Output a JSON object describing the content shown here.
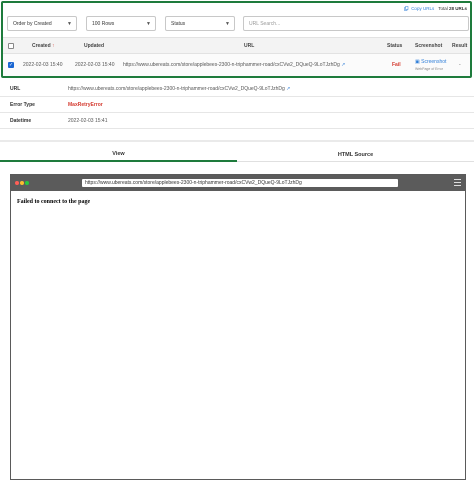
{
  "toolbar": {
    "copy_urls": "Copy URLs",
    "total_label": "Total",
    "total_value": "28 URLs"
  },
  "filters": {
    "order": "Order by Created",
    "rows": "100 Rows",
    "status": "Status",
    "search_placeholder": "URL Search..."
  },
  "table": {
    "headers": {
      "created": "Created",
      "updated": "Updated",
      "url": "URL",
      "status": "Status",
      "screenshot": "Screenshot",
      "result": "Result"
    },
    "row": {
      "created": "2022-02-03 15:40",
      "updated": "2022-02-03 15:40",
      "url": "https://www.ubereats.com/store/applebees-2300-n-triphammer-road/cxCVw2_DQueQ-9LoTJzhDg",
      "status": "Fail",
      "screenshot": "Screenshot",
      "screenshot_sub": "WebPage of Error",
      "result": "-"
    }
  },
  "details": {
    "url_label": "URL",
    "url_value": "https://www.ubereats.com/store/applebees-2300-n-triphammer-road/cxCVw2_DQueQ-9LoTJzhDg",
    "error_label": "Error Type",
    "error_value": "MaxRetryError",
    "date_label": "Datetime",
    "date_value": "2022-02-03 15:41"
  },
  "tabs": {
    "view": "View",
    "html_source": "HTML Source"
  },
  "browser": {
    "address": "https://www.ubereats.com/store/applebees-2300-n-triphammer-road/cxCVw2_DQueQ-9LoTJzhDg",
    "message": "Failed to connect to the page",
    "dot_colors": [
      "#ff5f57",
      "#febc2e",
      "#28c840"
    ]
  },
  "colors": {
    "accent": "#1e7b3c",
    "link": "#2f7ed8",
    "fail": "#d43a2f"
  }
}
